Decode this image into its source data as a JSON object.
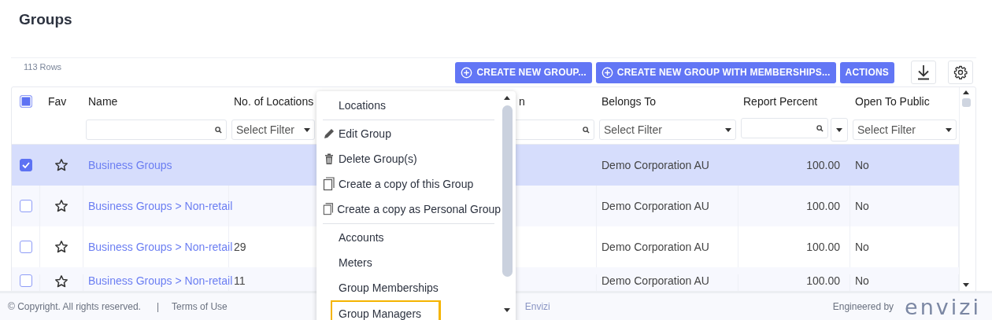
{
  "page_title": "Groups",
  "row_count": "113 Rows",
  "toolbar": [
    {
      "label": "CREATE NEW GROUP...",
      "kind": "create"
    },
    {
      "label": "CREATE NEW GROUP WITH MEMBERSHIPS...",
      "kind": "create"
    },
    {
      "label": "ACTIONS",
      "kind": "plain"
    }
  ],
  "select_all_checked": true,
  "columns": [
    {
      "label": "Fav",
      "kind": "none"
    },
    {
      "label": "Name",
      "kind": "text"
    },
    {
      "label": "No. of Locations",
      "kind": "select",
      "placeholder": "Select Filter"
    },
    {
      "label": "n",
      "kind": "text"
    },
    {
      "label": "Belongs To",
      "kind": "select",
      "placeholder": "Select Filter"
    },
    {
      "label": "Report Percent",
      "kind": "numeric"
    },
    {
      "label": "Open To Public",
      "kind": "select",
      "placeholder": "Select Filter"
    }
  ],
  "rows": [
    {
      "selected": true,
      "favorite": false,
      "name": "Business Groups",
      "belongs_to": "Demo Corporation AU",
      "report_percent": "100.00",
      "open_to_public": "No"
    },
    {
      "selected": false,
      "favorite": false,
      "name": "Business Groups > Non-retail",
      "belongs_to": "Demo Corporation AU",
      "report_percent": "100.00",
      "open_to_public": "No"
    },
    {
      "selected": false,
      "favorite": false,
      "name": "Business Groups > Non-retail",
      "locations": "29",
      "belongs_to": "Demo Corporation AU",
      "report_percent": "100.00",
      "open_to_public": "No"
    },
    {
      "selected": false,
      "favorite": false,
      "name": "Business Groups > Non-retail",
      "locations": "11",
      "belongs_to": "Demo Corporation AU",
      "report_percent": "100.00",
      "open_to_public": "No"
    }
  ],
  "context_menu": [
    {
      "kind": "header",
      "label": "Locations",
      "highlighted": false
    },
    {
      "kind": "divider"
    },
    {
      "kind": "edit",
      "label": "Edit Group",
      "highlighted": false
    },
    {
      "kind": "delete",
      "label": "Delete Group(s)",
      "highlighted": false
    },
    {
      "kind": "copy",
      "label": "Create a copy of this Group",
      "highlighted": false
    },
    {
      "kind": "copy",
      "label": "Create a copy as Personal Group",
      "highlighted": false
    },
    {
      "kind": "divider"
    },
    {
      "kind": "link",
      "label": "Accounts",
      "highlighted": false
    },
    {
      "kind": "link",
      "label": "Meters",
      "highlighted": false
    },
    {
      "kind": "link",
      "label": "Group Memberships",
      "highlighted": false
    },
    {
      "kind": "link",
      "label": "Group Managers",
      "highlighted": true
    }
  ],
  "footer": {
    "copyright": "© Copyright. All rights reserved.",
    "separator": "|",
    "terms": "Terms of Use",
    "powered": "Envizi",
    "engineered": "Engineered by",
    "logo": "envizi"
  }
}
